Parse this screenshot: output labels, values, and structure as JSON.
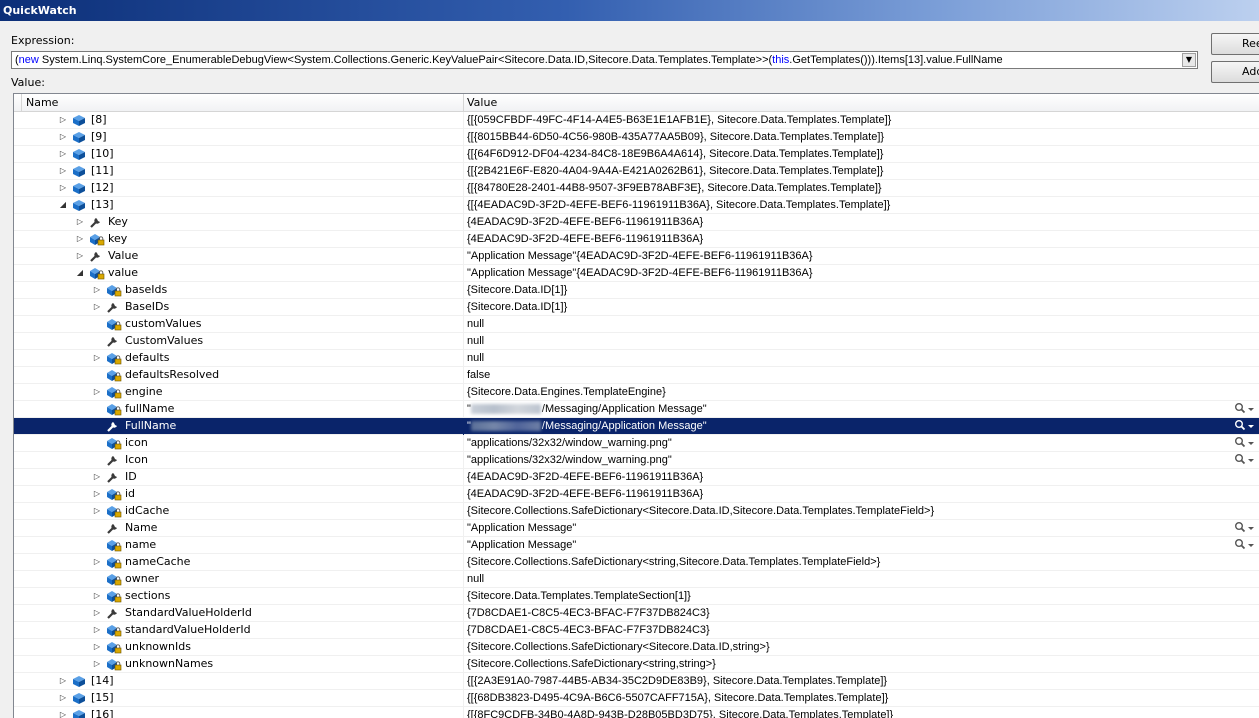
{
  "window": {
    "title": "QuickWatch"
  },
  "expression": {
    "label": "Expression:",
    "parts": [
      {
        "text": "(",
        "kind": "plain"
      },
      {
        "text": "new",
        "kind": "kw"
      },
      {
        "text": " System.Linq.SystemCore_EnumerableDebugView<",
        "kind": "plain"
      },
      {
        "text": "System.Collections.Generic.KeyValuePair",
        "kind": "plain"
      },
      {
        "text": "<",
        "kind": "plain"
      },
      {
        "text": "Sitecore.Data.ID,Sitecore.Data.Templates.Template",
        "kind": "plain"
      },
      {
        "text": ">>(",
        "kind": "plain"
      },
      {
        "text": "this",
        "kind": "kw"
      },
      {
        "text": ".GetTemplates())).Items[13].value.FullName",
        "kind": "plain"
      }
    ]
  },
  "buttons": {
    "reevaluate": "Reevaluate",
    "add_watch": "Add Watch"
  },
  "value_label": "Value:",
  "columns": {
    "name": "Name",
    "value": "Value"
  },
  "rows": [
    {
      "name": "[8]",
      "value": "{[{059CFBDF-49FC-4F14-A4E5-B63E1E1AFB1E}, Sitecore.Data.Templates.Template]}",
      "indent": 0,
      "exp": "collapsed",
      "icon": "field-icon"
    },
    {
      "name": "[9]",
      "value": "{[{8015BB44-6D50-4C56-980B-435A77AA5B09}, Sitecore.Data.Templates.Template]}",
      "indent": 0,
      "exp": "collapsed",
      "icon": "field-icon"
    },
    {
      "name": "[10]",
      "value": "{[{64F6D912-DF04-4234-84C8-18E9B6A4A614}, Sitecore.Data.Templates.Template]}",
      "indent": 0,
      "exp": "collapsed",
      "icon": "field-icon"
    },
    {
      "name": "[11]",
      "value": "{[{2B421E6F-E820-4A04-9A4A-E421A0262B61}, Sitecore.Data.Templates.Template]}",
      "indent": 0,
      "exp": "collapsed",
      "icon": "field-icon"
    },
    {
      "name": "[12]",
      "value": "{[{84780E28-2401-44B8-9507-3F9EB78ABF3E}, Sitecore.Data.Templates.Template]}",
      "indent": 0,
      "exp": "collapsed",
      "icon": "field-icon"
    },
    {
      "name": "[13]",
      "value": "{[{4EADAC9D-3F2D-4EFE-BEF6-11961911B36A}, Sitecore.Data.Templates.Template]}",
      "indent": 0,
      "exp": "expanded",
      "icon": "field-icon"
    },
    {
      "name": "Key",
      "value": "{4EADAC9D-3F2D-4EFE-BEF6-11961911B36A}",
      "indent": 1,
      "exp": "collapsed",
      "icon": "property-icon"
    },
    {
      "name": "key",
      "value": "{4EADAC9D-3F2D-4EFE-BEF6-11961911B36A}",
      "indent": 1,
      "exp": "collapsed",
      "icon": "private-field-icon"
    },
    {
      "name": "Value",
      "value": "\"Application Message\"{4EADAC9D-3F2D-4EFE-BEF6-11961911B36A}",
      "indent": 1,
      "exp": "collapsed",
      "icon": "property-icon"
    },
    {
      "name": "value",
      "value": "\"Application Message\"{4EADAC9D-3F2D-4EFE-BEF6-11961911B36A}",
      "indent": 1,
      "exp": "expanded",
      "icon": "private-field-icon"
    },
    {
      "name": "baseIds",
      "value": "{Sitecore.Data.ID[1]}",
      "indent": 2,
      "exp": "collapsed",
      "icon": "private-field-icon"
    },
    {
      "name": "BaseIDs",
      "value": "{Sitecore.Data.ID[1]}",
      "indent": 2,
      "exp": "collapsed",
      "icon": "property-icon"
    },
    {
      "name": "customValues",
      "value": "null",
      "indent": 2,
      "exp": "none",
      "icon": "private-field-icon"
    },
    {
      "name": "CustomValues",
      "value": "null",
      "indent": 2,
      "exp": "none",
      "icon": "property-icon"
    },
    {
      "name": "defaults",
      "value": "null",
      "indent": 2,
      "exp": "collapsed",
      "icon": "private-field-icon"
    },
    {
      "name": "defaultsResolved",
      "value": "false",
      "indent": 2,
      "exp": "none",
      "icon": "private-field-icon"
    },
    {
      "name": "engine",
      "value": "{Sitecore.Data.Engines.TemplateEngine}",
      "indent": 2,
      "exp": "collapsed",
      "icon": "private-field-icon"
    },
    {
      "name": "fullName",
      "value": "/Messaging/Application Message\"",
      "value_prefix": "\"",
      "redacted": true,
      "indent": 2,
      "exp": "none",
      "icon": "private-field-icon",
      "magnifier": true
    },
    {
      "name": "FullName",
      "value": "/Messaging/Application Message\"",
      "value_prefix": "\"",
      "redacted": true,
      "indent": 2,
      "exp": "none",
      "icon": "property-icon",
      "magnifier": true,
      "selected": true
    },
    {
      "name": "icon",
      "value": "\"applications/32x32/window_warning.png\"",
      "indent": 2,
      "exp": "none",
      "icon": "private-field-icon",
      "magnifier": true
    },
    {
      "name": "Icon",
      "value": "\"applications/32x32/window_warning.png\"",
      "indent": 2,
      "exp": "none",
      "icon": "property-icon",
      "magnifier": true
    },
    {
      "name": "ID",
      "value": "{4EADAC9D-3F2D-4EFE-BEF6-11961911B36A}",
      "indent": 2,
      "exp": "collapsed",
      "icon": "property-icon"
    },
    {
      "name": "id",
      "value": "{4EADAC9D-3F2D-4EFE-BEF6-11961911B36A}",
      "indent": 2,
      "exp": "collapsed",
      "icon": "private-field-icon"
    },
    {
      "name": "idCache",
      "value": "{Sitecore.Collections.SafeDictionary<Sitecore.Data.ID,Sitecore.Data.Templates.TemplateField>}",
      "indent": 2,
      "exp": "collapsed",
      "icon": "private-field-icon"
    },
    {
      "name": "Name",
      "value": "\"Application Message\"",
      "indent": 2,
      "exp": "none",
      "icon": "property-icon",
      "magnifier": true
    },
    {
      "name": "name",
      "value": "\"Application Message\"",
      "indent": 2,
      "exp": "none",
      "icon": "private-field-icon",
      "magnifier": true
    },
    {
      "name": "nameCache",
      "value": "{Sitecore.Collections.SafeDictionary<string,Sitecore.Data.Templates.TemplateField>}",
      "indent": 2,
      "exp": "collapsed",
      "icon": "private-field-icon"
    },
    {
      "name": "owner",
      "value": "null",
      "indent": 2,
      "exp": "none",
      "icon": "private-field-icon"
    },
    {
      "name": "sections",
      "value": "{Sitecore.Data.Templates.TemplateSection[1]}",
      "indent": 2,
      "exp": "collapsed",
      "icon": "private-field-icon"
    },
    {
      "name": "StandardValueHolderId",
      "value": "{7D8CDAE1-C8C5-4EC3-BFAC-F7F37DB824C3}",
      "indent": 2,
      "exp": "collapsed",
      "icon": "property-icon"
    },
    {
      "name": "standardValueHolderId",
      "value": "{7D8CDAE1-C8C5-4EC3-BFAC-F7F37DB824C3}",
      "indent": 2,
      "exp": "collapsed",
      "icon": "private-field-icon"
    },
    {
      "name": "unknownIds",
      "value": "{Sitecore.Collections.SafeDictionary<Sitecore.Data.ID,string>}",
      "indent": 2,
      "exp": "collapsed",
      "icon": "private-field-icon"
    },
    {
      "name": "unknownNames",
      "value": "{Sitecore.Collections.SafeDictionary<string,string>}",
      "indent": 2,
      "exp": "collapsed",
      "icon": "private-field-icon"
    },
    {
      "name": "[14]",
      "value": "{[{2A3E91A0-7987-44B5-AB34-35C2D9DE83B9}, Sitecore.Data.Templates.Template]}",
      "indent": 0,
      "exp": "collapsed",
      "icon": "field-icon"
    },
    {
      "name": "[15]",
      "value": "{[{68DB3823-D495-4C9A-B6C6-5507CAFF715A}, Sitecore.Data.Templates.Template]}",
      "indent": 0,
      "exp": "collapsed",
      "icon": "field-icon"
    },
    {
      "name": "[16]",
      "value": "{[{8FC9CDFB-34B0-4A8D-943B-D28B05BD3D75}, Sitecore.Data.Templates.Template]}",
      "indent": 0,
      "exp": "collapsed",
      "icon": "field-icon"
    }
  ],
  "colors": {
    "selection": "#0a246a",
    "keyword": "#0000ff",
    "field_icon": "#1b6fc8"
  }
}
